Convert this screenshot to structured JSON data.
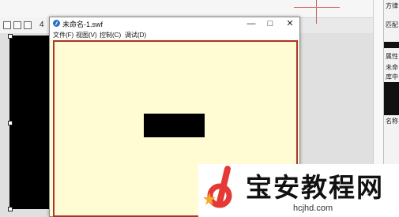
{
  "background_app": {
    "toolbar_number": "4",
    "right_panel": {
      "text_lines": [
        "方律",
        "匹配",
        "属性",
        "未命",
        "库中",
        "名称"
      ]
    }
  },
  "swf_window": {
    "title": "未命名-1.swf",
    "menu": [
      "文件(F)",
      "视图(V)",
      "控制(C)",
      "调试(D)"
    ],
    "controls": {
      "minimize": "—",
      "maximize": "□",
      "close": "✕"
    },
    "content": {
      "background_color": "#fffbd2",
      "border_color": "#aa3333",
      "shape_color": "#000000"
    }
  },
  "watermark": {
    "title": "宝安教程网",
    "url": "hcjhd.com"
  }
}
